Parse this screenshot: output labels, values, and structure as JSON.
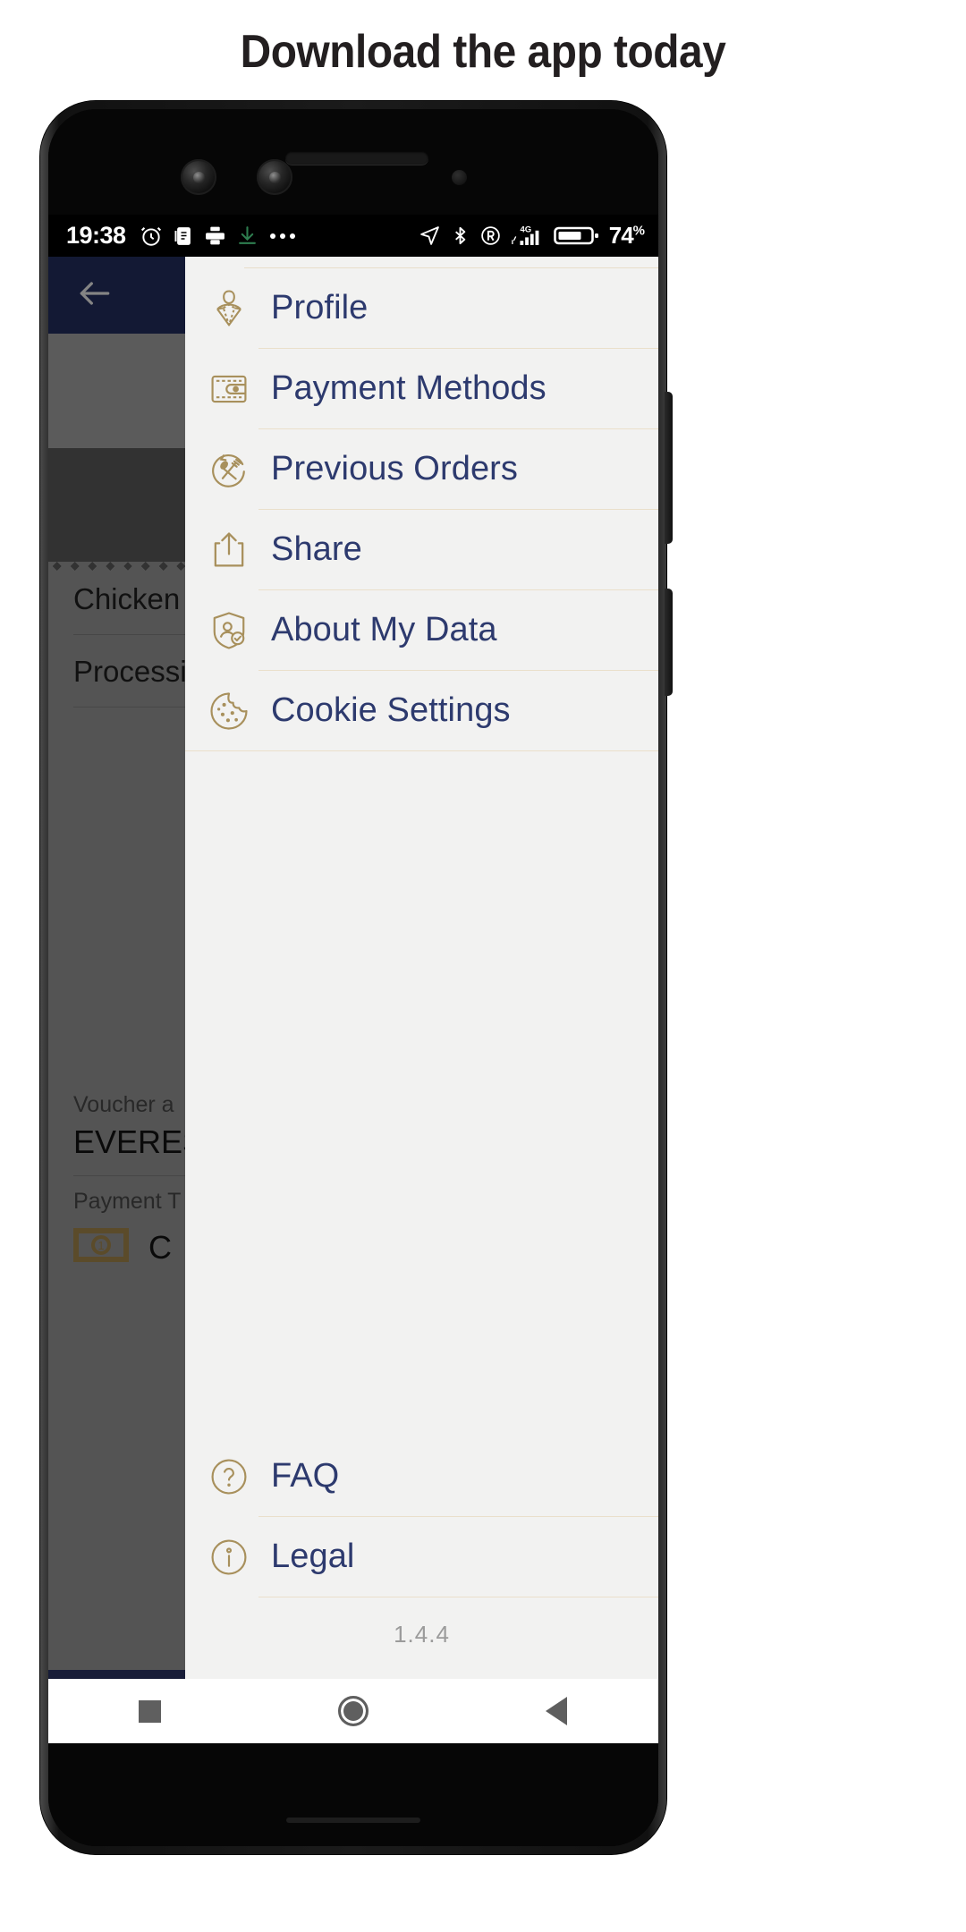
{
  "headline": "Download the app today",
  "statusbar": {
    "time": "19:38",
    "left_icons": [
      "alarm-icon",
      "notes-icon",
      "print-icon",
      "download-icon",
      "more-dots-icon"
    ],
    "right_icons": [
      "location-icon",
      "bluetooth-icon",
      "roaming-icon",
      "signal-4g-icon"
    ],
    "network": "4G",
    "battery_percent": "74",
    "battery_percent_symbol": "%"
  },
  "drawer": {
    "items": [
      {
        "label": "Profile",
        "icon": "profile-icon"
      },
      {
        "label": "Payment Methods",
        "icon": "wallet-icon"
      },
      {
        "label": "Previous Orders",
        "icon": "cutlery-history-icon"
      },
      {
        "label": "Share",
        "icon": "share-icon"
      },
      {
        "label": "About My Data",
        "icon": "shield-person-icon"
      },
      {
        "label": "Cookie Settings",
        "icon": "cookie-icon"
      }
    ],
    "footer_items": [
      {
        "label": "FAQ",
        "icon": "question-circle-icon"
      },
      {
        "label": "Legal",
        "icon": "info-circle-icon"
      }
    ],
    "version": "1.4.4"
  },
  "background": {
    "back_label": "back-arrow",
    "rows": [
      "Chicken",
      "Processing"
    ],
    "voucher_label": "Voucher a",
    "voucher_code": "EVERES",
    "payment_label": "Payment T",
    "payment_value": "C"
  },
  "navbar": {
    "recents": "recents-button",
    "home": "home-button",
    "back": "back-button"
  },
  "colors": {
    "accent_gold": "#a8905c",
    "text_navy": "#2d3a6e",
    "appbar_navy": "#1d2650",
    "drawer_bg": "#f2f2f1",
    "rule": "#eadfcb"
  }
}
